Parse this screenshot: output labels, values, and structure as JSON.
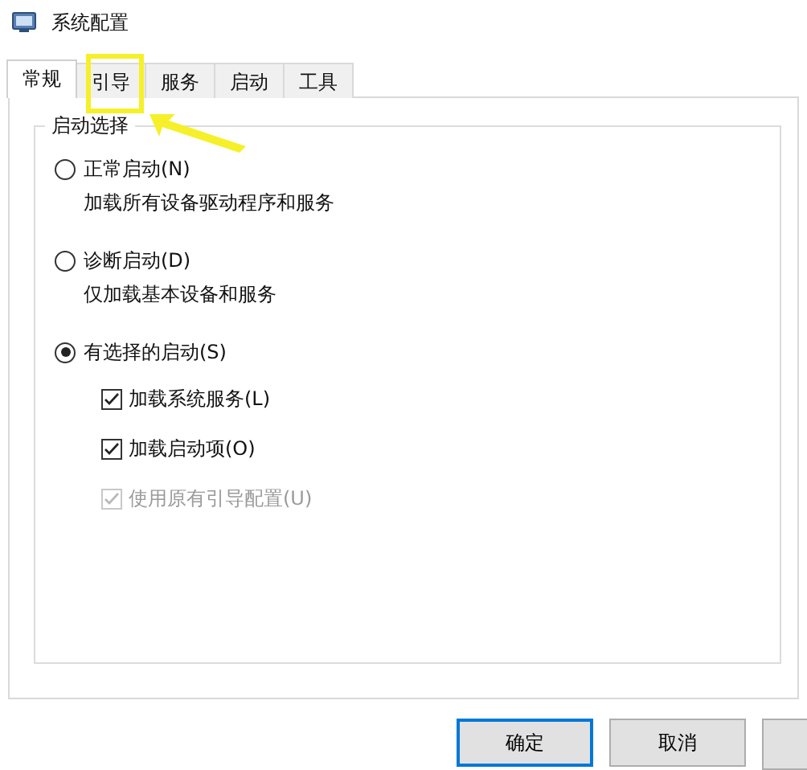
{
  "window": {
    "title": "系统配置"
  },
  "tabs": [
    {
      "label": "常规",
      "selected": true
    },
    {
      "label": "引导",
      "selected": false
    },
    {
      "label": "服务",
      "selected": false
    },
    {
      "label": "启动",
      "selected": false
    },
    {
      "label": "工具",
      "selected": false
    }
  ],
  "startup_selection": {
    "title": "启动选择",
    "options": [
      {
        "label": "正常启动(N)",
        "selected": false,
        "description": "加载所有设备驱动程序和服务"
      },
      {
        "label": "诊断启动(D)",
        "selected": false,
        "description": "仅加载基本设备和服务"
      },
      {
        "label": "有选择的启动(S)",
        "selected": true
      }
    ],
    "selective_items": [
      {
        "label": "加载系统服务(L)",
        "checked": true,
        "disabled": false
      },
      {
        "label": "加载启动项(O)",
        "checked": true,
        "disabled": false
      },
      {
        "label": "使用原有引导配置(U)",
        "checked": true,
        "disabled": true
      }
    ]
  },
  "buttons": [
    {
      "label": "确定",
      "default": true
    },
    {
      "label": "取消",
      "default": false
    }
  ],
  "cut_off_button": true
}
